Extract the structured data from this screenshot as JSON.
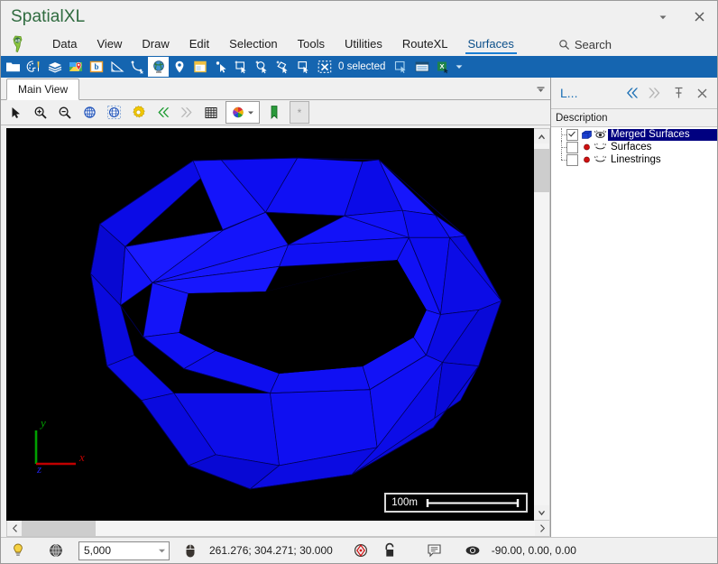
{
  "window": {
    "title": "SpatialXL",
    "title_color": "#2f6b3f",
    "dropdown_icon": "chevron-down-icon",
    "close_icon": "close-icon"
  },
  "menubar": {
    "logo_icon": "app-logo-icon",
    "items": [
      {
        "label": "Data",
        "active": false
      },
      {
        "label": "View",
        "active": false
      },
      {
        "label": "Draw",
        "active": false
      },
      {
        "label": "Edit",
        "active": false
      },
      {
        "label": "Selection",
        "active": false
      },
      {
        "label": "Tools",
        "active": false
      },
      {
        "label": "Utilities",
        "active": false
      },
      {
        "label": "RouteXL",
        "active": false
      },
      {
        "label": "Surfaces",
        "active": true
      }
    ],
    "search": {
      "label": "Search",
      "icon": "search-icon"
    }
  },
  "ribbon": {
    "background": "#1565b0",
    "buttons": [
      {
        "name": "open-folder-icon"
      },
      {
        "name": "palette-brush-icon"
      },
      {
        "name": "layers-icon"
      },
      {
        "name": "map-pin-icon"
      },
      {
        "name": "boundary-b-icon"
      },
      {
        "name": "measure-angle-icon"
      },
      {
        "name": "curve-delete-icon"
      },
      {
        "name": "globe-icon"
      },
      {
        "name": "location-pin-icon"
      },
      {
        "name": "page-layout-icon"
      },
      {
        "name": "point-select-icon"
      },
      {
        "name": "rectangle-select-icon"
      },
      {
        "name": "circle-select-icon"
      },
      {
        "name": "polygon-select-icon"
      },
      {
        "name": "crop-select-icon"
      },
      {
        "name": "clear-selection-icon"
      }
    ],
    "selection_label": "0 selected",
    "after_buttons": [
      {
        "name": "duplicate-selection-icon"
      },
      {
        "name": "table-view-icon"
      },
      {
        "name": "export-excel-icon"
      }
    ],
    "overflow_icon": "chevron-down-icon"
  },
  "tabs": {
    "items": [
      {
        "label": "Main View",
        "active": true
      }
    ],
    "overflow_icon": "chevron-down-icon"
  },
  "viewbar": {
    "buttons": [
      {
        "name": "select-arrow-icon"
      },
      {
        "name": "zoom-in-icon"
      },
      {
        "name": "zoom-out-icon"
      },
      {
        "name": "globe-view-icon"
      },
      {
        "name": "globe-extent-icon"
      },
      {
        "name": "settings-gear-icon"
      },
      {
        "name": "previous-view-icon"
      },
      {
        "name": "next-view-icon"
      },
      {
        "name": "grid-icon"
      },
      {
        "name": "color-palette-icon"
      },
      {
        "name": "bookmark-icon"
      },
      {
        "name": "favorite-star-icon"
      }
    ],
    "favorite_glyph": "*"
  },
  "viewport": {
    "background": "#000000",
    "axis": {
      "x_label": "x",
      "y_label": "y",
      "z_label": "z",
      "x_color": "#cc0000",
      "y_color": "#00aa00",
      "z_color": "#0000ee"
    },
    "scalebar": {
      "label": "100m"
    },
    "mesh": {
      "name": "Merged Surfaces",
      "fill_color": "#0000e0",
      "fill_color_light": "#1515ff",
      "fill_color_dark": "#0000b4",
      "edge_color": "#000060"
    },
    "vscroll": {
      "up_icon": "chevron-up-icon",
      "down_icon": "chevron-down-icon"
    },
    "hscroll": {
      "left_icon": "chevron-left-icon",
      "right_icon": "chevron-right-icon"
    }
  },
  "right_panel": {
    "title": "L...",
    "back_icon": "double-chevron-left-icon",
    "forward_icon": "double-chevron-right-icon",
    "pin_icon": "pin-icon",
    "close_icon": "close-icon",
    "column_header": "Description",
    "selection_color": "#000080",
    "items": [
      {
        "label": "Merged Surfaces",
        "checked": true,
        "selected": true,
        "type_icon": "solid-block-icon",
        "type_color": "#1a3fd0",
        "visibility_icon": "visible-eye-icon"
      },
      {
        "label": "Surfaces",
        "checked": false,
        "selected": false,
        "type_icon": "point-marker-icon",
        "type_color": "#d01010",
        "visibility_icon": "hidden-eye-icon"
      },
      {
        "label": "Linestrings",
        "checked": false,
        "selected": false,
        "type_icon": "point-marker-icon",
        "type_color": "#d01010",
        "visibility_icon": "hidden-eye-icon"
      }
    ]
  },
  "statusbar": {
    "hint_icon": "lightbulb-icon",
    "projection_icon": "globe-wire-icon",
    "scale_value": "5,000",
    "scale_dropdown_icon": "chevron-down-icon",
    "cursor_icon": "mouse-icon",
    "coordinates": "261.276; 304.271; 30.000",
    "snap_icon": "snap-target-icon",
    "lock_icon": "lock-open-icon",
    "message_icon": "message-icon",
    "eye_icon": "eye-icon",
    "rotation": "-90.00, 0.00, 0.00"
  }
}
